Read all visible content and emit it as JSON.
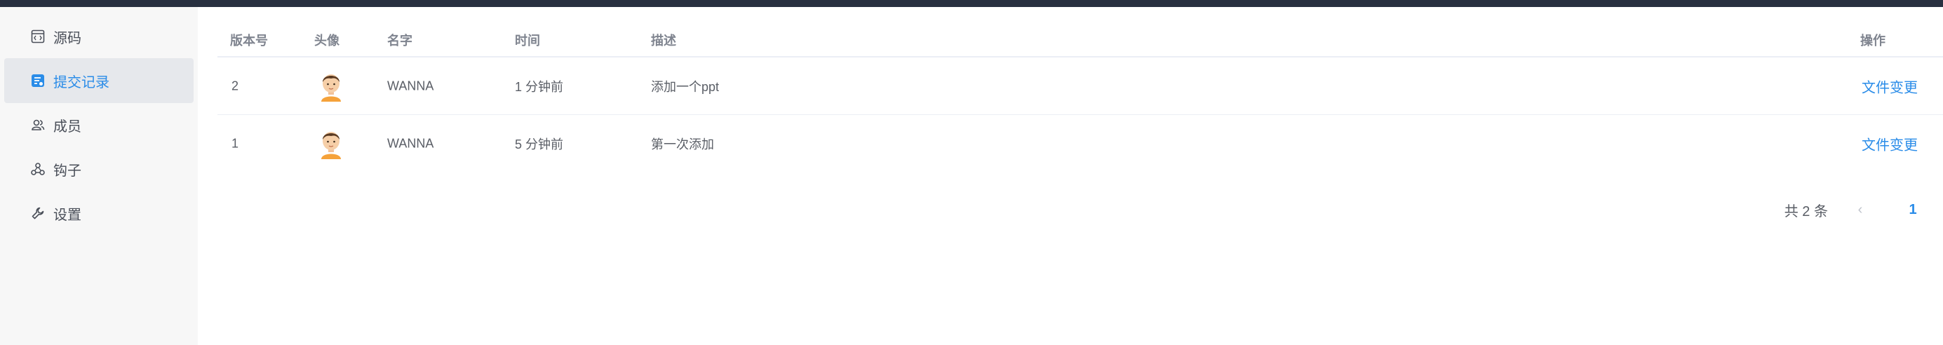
{
  "sidebar": {
    "items": [
      {
        "label": "源码",
        "icon": "code-icon",
        "active": false
      },
      {
        "label": "提交记录",
        "icon": "commit-log-icon",
        "active": true
      },
      {
        "label": "成员",
        "icon": "users-icon",
        "active": false
      },
      {
        "label": "钩子",
        "icon": "webhook-icon",
        "active": false
      },
      {
        "label": "设置",
        "icon": "wrench-icon",
        "active": false
      }
    ]
  },
  "table": {
    "headers": {
      "version": "版本号",
      "avatar": "头像",
      "name": "名字",
      "time": "时间",
      "desc": "描述",
      "action": "操作"
    },
    "rows": [
      {
        "version": "2",
        "name": "WANNA",
        "time": "1 分钟前",
        "desc": "添加一个ppt",
        "action": "文件变更"
      },
      {
        "version": "1",
        "name": "WANNA",
        "time": "5 分钟前",
        "desc": "第一次添加",
        "action": "文件变更"
      }
    ]
  },
  "pagination": {
    "total": "共 2 条",
    "prev": "‹",
    "current": "1"
  },
  "colors": {
    "accent": "#2a8ce8",
    "topbar": "#283040",
    "sidebar_bg": "#f7f7f7",
    "active_bg": "#e6e8ec"
  }
}
